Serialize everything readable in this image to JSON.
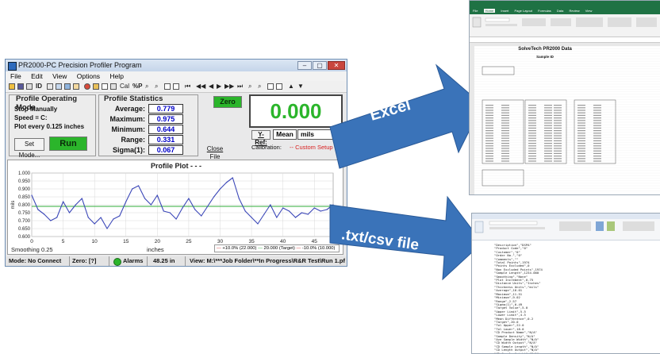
{
  "app": {
    "title": "PR2000-PC Precision Profiler Program",
    "window_controls": [
      "–",
      "▢",
      "✕"
    ],
    "menu": [
      "File",
      "Edit",
      "View",
      "Options",
      "Help"
    ],
    "toolbar": {
      "id_label": "ID",
      "cal_label": "Cal",
      "np_label": "%P"
    }
  },
  "operating_mode": {
    "title": "Profile Operating Mode",
    "lines": [
      "Stop Manually",
      "Speed = C:",
      "Plot every 0.125 inches"
    ],
    "set_mode_button": "Set Mode...",
    "run_button": "Run"
  },
  "statistics": {
    "title": "Profile Statistics",
    "rows": [
      {
        "label": "Average:",
        "value": "0.779"
      },
      {
        "label": "Maximum:",
        "value": "0.975"
      },
      {
        "label": "Minimum:",
        "value": "0.644"
      },
      {
        "label": "Range:",
        "value": "0.331"
      },
      {
        "label": "Sigma(1):",
        "value": "0.067"
      }
    ],
    "close_file_button": "Close File"
  },
  "readout": {
    "zero_button": "Zero",
    "value": "0.000",
    "yref_button": "Y-Ref:",
    "mean_label": "Mean",
    "unit": "mils",
    "calibration_label": "Calibration:",
    "calibration_value": "-- Custom Setup --"
  },
  "plot": {
    "title": "Profile Plot - - -",
    "smoothing": "Smoothing 0.25",
    "xlabel": "inches",
    "legend": [
      "+10.0% (22.000)",
      "20.000 (Target)",
      "-10.0% (10.000)"
    ]
  },
  "chart_data": {
    "type": "line",
    "ylabel": "mils",
    "ylim": [
      0.6,
      1.0
    ],
    "xlim": [
      0,
      48
    ],
    "xticks": [
      0,
      5,
      10,
      15,
      20,
      25,
      30,
      35,
      40,
      45
    ],
    "yticks": [
      "0.600",
      "0.650",
      "0.700",
      "0.750",
      "0.800",
      "0.850",
      "0.900",
      "0.950",
      "1.000"
    ],
    "grid": true,
    "target": 0.79,
    "target_color": "#2fae3a",
    "series_color": "#3b47b8",
    "x": [
      0,
      1,
      2,
      3,
      4,
      5,
      6,
      7,
      8,
      9,
      10,
      11,
      12,
      13,
      14,
      15,
      16,
      17,
      18,
      19,
      20,
      21,
      22,
      23,
      24,
      25,
      26,
      27,
      28,
      29,
      30,
      31,
      32,
      33,
      34,
      35,
      36,
      37,
      38,
      39,
      40,
      41,
      42,
      43,
      44,
      45,
      46,
      47,
      48
    ],
    "values": [
      0.86,
      0.77,
      0.74,
      0.7,
      0.72,
      0.82,
      0.75,
      0.8,
      0.84,
      0.72,
      0.68,
      0.72,
      0.65,
      0.71,
      0.73,
      0.82,
      0.9,
      0.92,
      0.84,
      0.8,
      0.86,
      0.76,
      0.75,
      0.71,
      0.78,
      0.84,
      0.77,
      0.73,
      0.79,
      0.85,
      0.9,
      0.94,
      0.97,
      0.84,
      0.76,
      0.72,
      0.68,
      0.74,
      0.8,
      0.72,
      0.78,
      0.76,
      0.72,
      0.75,
      0.74,
      0.78,
      0.76,
      0.77,
      0.8
    ]
  },
  "statusbar": {
    "mode": "Mode: No Connect",
    "zero": "Zero: [?]",
    "alarms": "Alarms",
    "distance": "48.25 in",
    "view": "View: M:\\***Job Folder\\**In Progress\\R&R Test\\Run 1.pfl"
  },
  "arrows": {
    "excel_label": "Excel",
    "txt_label": ".txt/csv file",
    "color": "#3a73b9"
  },
  "excel_thumb": {
    "title": "SolveTech PR2000 Data",
    "subtitle": "Sample ID",
    "tabs": [
      "File",
      "Home",
      "Insert",
      "Page Layout",
      "Formulas",
      "Data",
      "Review",
      "View"
    ]
  },
  "notepad_thumb": {
    "lines": [
      "\"Description\",\"DSPA\"",
      "\"Product Code\",\"0\"",
      "\"Customer\",\"0\"",
      "\"Order No.\",\"0\"",
      "\"Comments\",\"\"",
      "\"Total Points\",1974",
      "\"Points Excluded\",0",
      "\"Non Excluded Points\",1974",
      "\"Sample Length\",1234.000",
      "\"Smoothing\",\"None\"",
      "\"Plot Increment\",0.75",
      "\"Distance Units\",\"Inches\"",
      "\"Thickness Units\",\"mils\"",
      "\"Average\",10.01",
      "\"Maximum\",11.51",
      "\"Minimum\",9.02",
      "\"Range\",2.57",
      "\"Sigma(1)\",0.49",
      "\"Target Value\",5.0",
      "\"Upper Limit\",5.5",
      "\"Lower Limit\",4.5",
      "\"Mean Difference\",0.2",
      "\"Target\",20.0",
      "\"Tol Upper\",22.0",
      "\"Tol Lower\",18.0",
      "\"CD Product Name\",\"N/A\"",
      "\"Sample Density\",\"N/A\"",
      "\"Ave Sample Width\",\"N/A\"",
      "\"CD Width Output\",\"N/A\"",
      "\"CD Sample Length\",\"N/A\"",
      "\"CD Length Output\",\"N/A\"",
      "\"CD Sample Height\",\"N/A\""
    ]
  }
}
